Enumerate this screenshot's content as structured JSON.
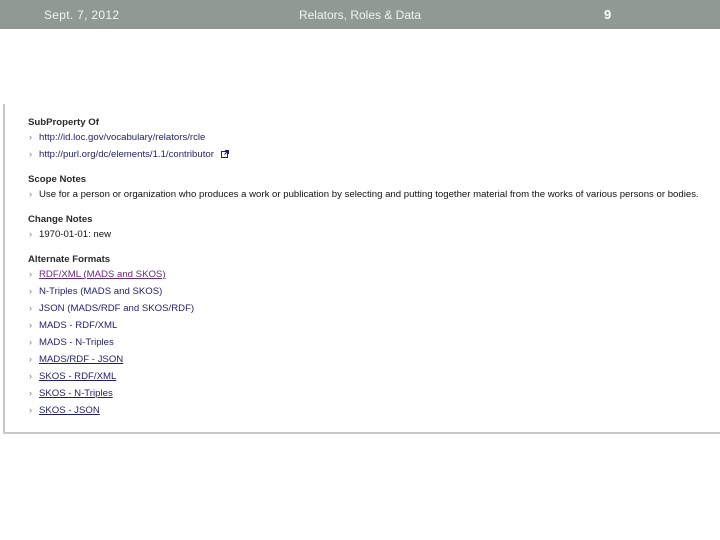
{
  "header": {
    "date": "Sept. 7, 2012",
    "title": "Relators, Roles & Data",
    "page_number": "9"
  },
  "sections": {
    "subproperty": {
      "heading": "SubProperty Of",
      "items": [
        "http://id.loc.gov/vocabulary/relators/rcle",
        "http://purl.org/dc/elements/1.1/contributor"
      ]
    },
    "scope": {
      "heading": "Scope Notes",
      "items": [
        "Use for a person or organization who produces a work or publication by selecting and putting together material from the works of various persons or bodies."
      ]
    },
    "change": {
      "heading": "Change Notes",
      "items": [
        "1970-01-01: new"
      ]
    },
    "formats": {
      "heading": "Alternate Formats",
      "items": [
        "RDF/XML (MADS and SKOS)",
        "N-Triples (MADS and SKOS)",
        "JSON (MADS/RDF and SKOS/RDF)",
        "MADS - RDF/XML",
        "MADS - N-Triples",
        "MADS/RDF - JSON",
        "SKOS - RDF/XML",
        "SKOS - N-Triples",
        "SKOS - JSON"
      ]
    }
  },
  "icons": {
    "chevron": "chevron-right-icon",
    "external": "external-link-icon"
  },
  "colors": {
    "header_band": "#8f9a92",
    "link": "#1f1f6e",
    "visited_link": "#6a2a7a"
  }
}
